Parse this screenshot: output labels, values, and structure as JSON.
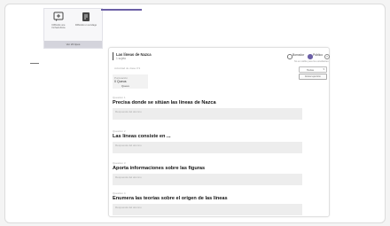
{
  "toolbar": {
    "tools": [
      {
        "icon": "add-question-icon",
        "label": "Difficulté une Ficha/rubrica"
      },
      {
        "icon": "document-icon",
        "label": "Difficulté un sondage"
      }
    ],
    "section_label": "Ver 20 tipos"
  },
  "card": {
    "title": "Las líneas de Nazca",
    "subtitle": "1 sujeto",
    "meta": "Actividad de clase  # 9",
    "points": {
      "label": "Puntuación",
      "value": "0 Queus",
      "unit": "Queus"
    }
  },
  "mode": {
    "options": [
      {
        "label": "Borrador",
        "selected": false
      },
      {
        "label": "Público",
        "selected": true
      }
    ],
    "visible_note": "No es visible para los estudiantes",
    "dropdown_value": "Todos",
    "action_label": "Enviar ejercicio"
  },
  "questions": [
    {
      "num": "Question 1",
      "text": "Precisa donde se sitúan las líneas de Nazca",
      "placeholder": "Respuesta del alumno"
    },
    {
      "num": "Question 2",
      "text": "Las  líneas consiste en ...",
      "placeholder": "Respuesta del alumno"
    },
    {
      "num": "Question 3",
      "text": "Aporta informaciones sobre las figuras",
      "placeholder": "Respuesta del alumno"
    },
    {
      "num": "Question 4",
      "text": "Enumera las teorías sobre el origen de las líneas",
      "placeholder": "Respuesta del alumno"
    }
  ],
  "colors": {
    "accent": "#6b5fa6",
    "answer_bg": "#ededed"
  }
}
